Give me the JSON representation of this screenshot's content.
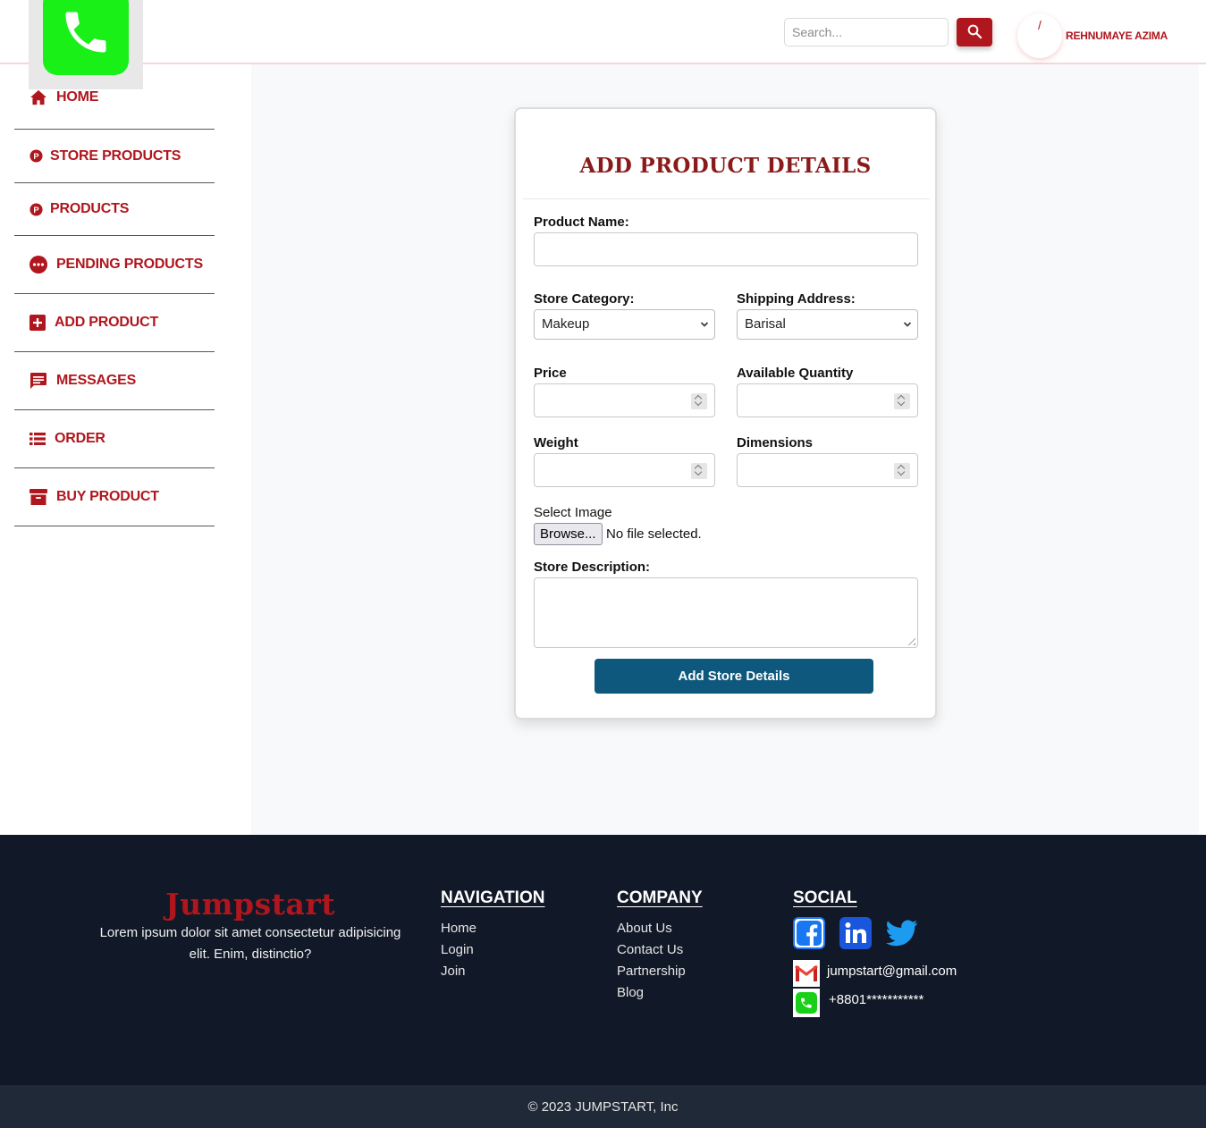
{
  "header": {
    "search_placeholder": "Search...",
    "avatar_glyph": "/",
    "username": "REHNUMAYE AZIMA"
  },
  "sidebar": {
    "items": [
      {
        "label": "HOME",
        "icon": "home-icon"
      },
      {
        "label": "STORE PRODUCTS",
        "icon": "product-p-icon"
      },
      {
        "label": "PRODUCTS",
        "icon": "product-p-icon"
      },
      {
        "label": "PENDING PRODUCTS",
        "icon": "pending-dots-icon"
      },
      {
        "label": "ADD PRODUCT",
        "icon": "add-box-icon"
      },
      {
        "label": "MESSAGES",
        "icon": "message-icon"
      },
      {
        "label": "ORDER",
        "icon": "list-icon"
      },
      {
        "label": "BUY PRODUCT",
        "icon": "archive-icon"
      }
    ]
  },
  "form": {
    "title": "ADD PRODUCT DETAILS",
    "product_name_label": "Product Name:",
    "product_name_value": "",
    "store_category_label": "Store Category:",
    "store_category_value": "Makeup",
    "shipping_address_label": "Shipping Address:",
    "shipping_address_value": "Barisal",
    "price_label": "Price",
    "price_value": "",
    "quantity_label": "Available Quantity",
    "quantity_value": "",
    "weight_label": "Weight",
    "weight_value": "",
    "dimensions_label": "Dimensions",
    "dimensions_value": "",
    "select_image_label": "Select Image",
    "browse_label": "Browse...",
    "no_file_text": "No file selected.",
    "description_label": "Store Description:",
    "description_value": "",
    "submit_label": "Add Store Details"
  },
  "footer": {
    "brand": "Jumpstart",
    "description": "Lorem ipsum dolor sit amet consectetur adipisicing elit. Enim, distinctio?",
    "navigation": {
      "heading": "NAVIGATION",
      "links": [
        "Home",
        "Login",
        "Join"
      ]
    },
    "company": {
      "heading": "COMPANY",
      "links": [
        "About Us",
        "Contact Us",
        "Partnership",
        "Blog"
      ]
    },
    "social": {
      "heading": "SOCIAL",
      "icons": [
        "facebook-icon",
        "linkedin-icon",
        "twitter-icon"
      ],
      "email": "jumpstart@gmail.com",
      "phone": "+8801***********"
    },
    "copyright": "© 2023 JUMPSTART, Inc"
  },
  "colors": {
    "accent": "#b0161d",
    "title": "#8b1a1a",
    "submit": "#0f587d",
    "footer_bg": "#111827",
    "bottom_bar": "#1f2937"
  }
}
